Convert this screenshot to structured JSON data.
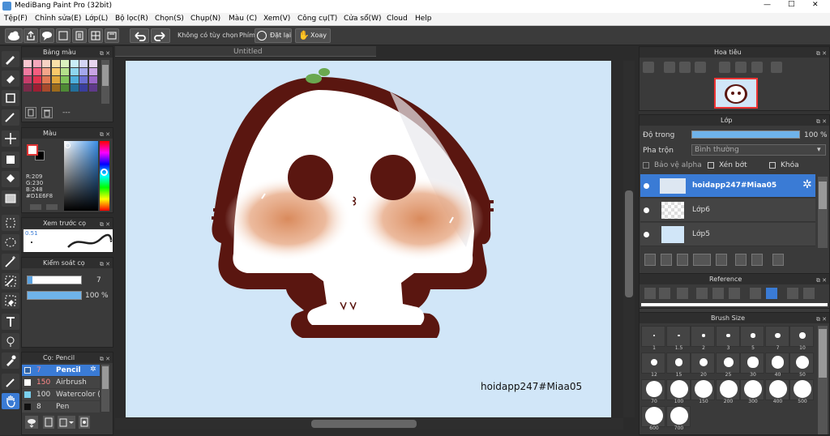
{
  "window": {
    "title": "MediBang Paint Pro (32bit)",
    "minimize": "—",
    "maximize": "□",
    "close": "✕"
  },
  "menu": [
    "Tệp(F)",
    "Chỉnh sửa(E)",
    "Lớp(L)",
    "Bộ lọc(R)",
    "Chọn(S)",
    "Chụp(N)",
    "Màu (C)",
    "Xem(V)",
    "Công cụ(T)",
    "Cửa sổ(W)",
    "Cloud",
    "Help"
  ],
  "toolbar": {
    "no_options": "Không có tùy chọn",
    "keys_label": "Phím",
    "reset_label": "Đặt lại",
    "rotate_label": "Xoay"
  },
  "swatches_panel": {
    "title": "Bảng màu",
    "more": "---",
    "colors": [
      "#f8c6d0",
      "#f5a7bb",
      "#f7d2c4",
      "#f9e0a8",
      "#d9f0bd",
      "#c9edf8",
      "#d4d4f5",
      "#e7d4ef",
      "#f07aa0",
      "#f55d7f",
      "#f4a58a",
      "#f9c96b",
      "#b3e08a",
      "#8fd6ef",
      "#a4a7ec",
      "#c9a4e4",
      "#c63d6b",
      "#e0334f",
      "#e07955",
      "#e1a73b",
      "#7fc35a",
      "#4fb0dc",
      "#6b6fd3",
      "#9b67c9",
      "#7a2b4a",
      "#9d1e33",
      "#a84a2c",
      "#9c6b1c",
      "#4e8a35",
      "#236f9a",
      "#3a3e9c",
      "#5f3a8a"
    ]
  },
  "color_panel": {
    "title": "Màu",
    "r": "R:209",
    "g": "G:230",
    "b": "B:248",
    "hex": "#D1E6F8",
    "main_color": "#ffffff",
    "sub_color": "#000000",
    "current": "#D1E6F8"
  },
  "preview_panel": {
    "title": "Xem trước cọ",
    "size_label": "0.51"
  },
  "brush_control": {
    "title": "Kiểm soát cọ",
    "size_value": "7",
    "opacity_value": "100 %"
  },
  "brushes_panel": {
    "title": "Cọ: Pencil",
    "items": [
      {
        "size": "7",
        "name": "Pencil",
        "color": "#3a6fb0",
        "active": true
      },
      {
        "size": "150",
        "name": "Airbrush",
        "color": "#ffffff",
        "active": false
      },
      {
        "size": "100",
        "name": "Watercolor (W",
        "color": "#7ad0ee",
        "active": false
      },
      {
        "size": "8",
        "name": "Pen",
        "color": "#111111",
        "active": false
      }
    ]
  },
  "canvas": {
    "tab_title": "Untitled",
    "watermark": "hoidapp247#Miaa05",
    "background": "#D1E6F8"
  },
  "navigator": {
    "title": "Hoa tiêu"
  },
  "layers": {
    "title": "Lớp",
    "opacity_label": "Độ trong",
    "opacity_value": "100 %",
    "blend_label": "Pha trộn",
    "blend_value": "Bình thường",
    "protect_alpha": "Bảo vệ alpha",
    "clip": "Xén bớt",
    "lock": "Khóa",
    "items": [
      {
        "name": "hoidapp247#Miaa05",
        "active": true
      },
      {
        "name": "Lớp6",
        "active": false
      },
      {
        "name": "Lớp5",
        "active": false
      }
    ]
  },
  "reference": {
    "title": "Reference"
  },
  "brush_size": {
    "title": "Brush Size",
    "sizes": [
      "1",
      "1.5",
      "2",
      "3",
      "5",
      "7",
      "10",
      "12",
      "15",
      "20",
      "25",
      "30",
      "40",
      "50",
      "70",
      "100",
      "150",
      "200",
      "300",
      "400",
      "500",
      "600",
      "700"
    ]
  }
}
